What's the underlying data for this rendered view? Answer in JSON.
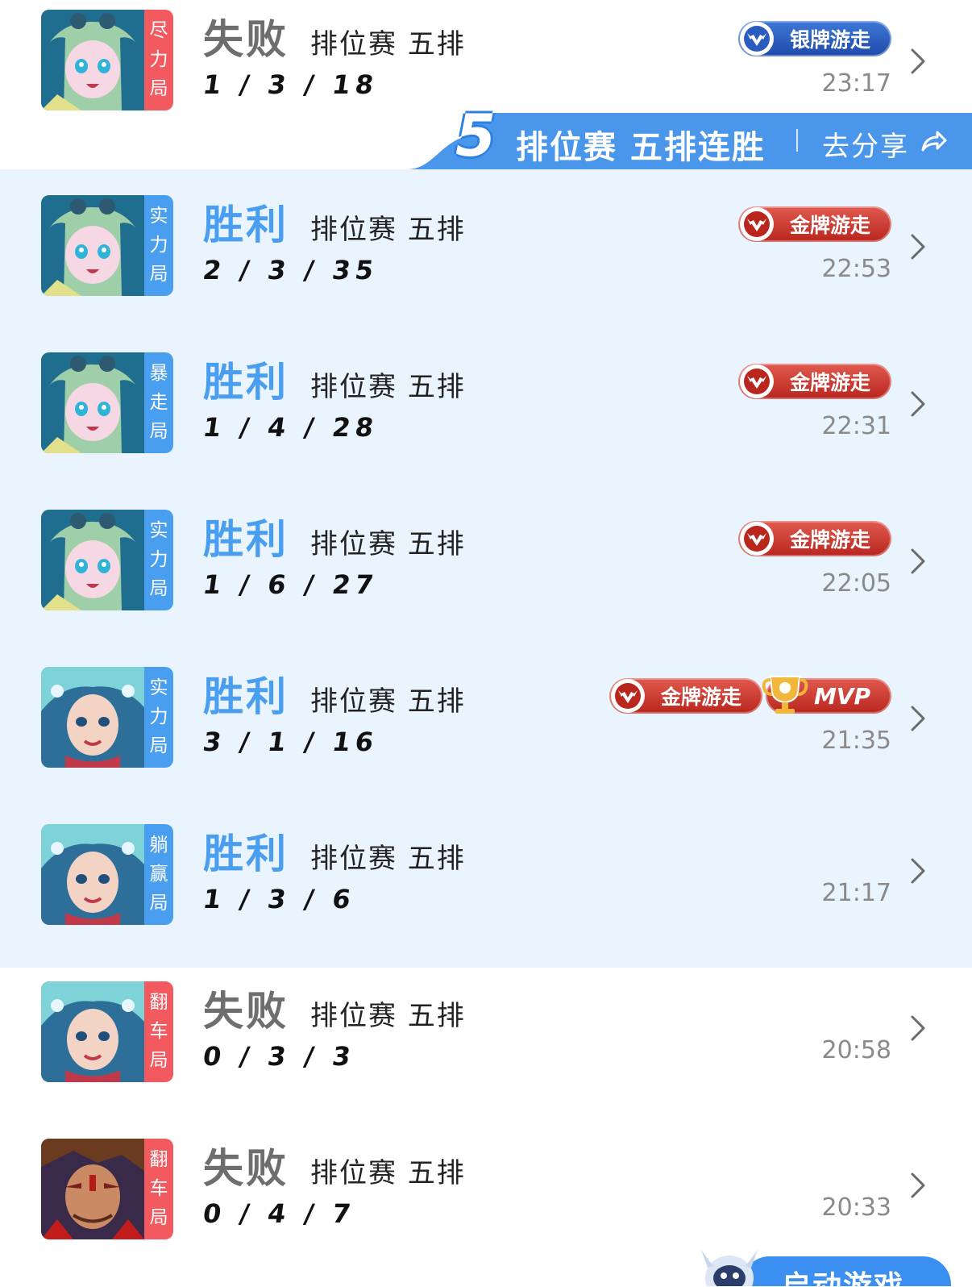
{
  "colors": {
    "win": "#4a9ef0",
    "loss": "#6e6e6e",
    "tag_win": "#4a9ef0",
    "tag_loss": "#f25a5f",
    "highlight_bg": "#e9f4fe",
    "gold_badge": "#c9322a",
    "silver_badge": "#2a5cc0"
  },
  "streak_banner": {
    "count": "5",
    "title": "排位赛 五排连胜",
    "share_label": "去分享",
    "icon": "share-arrow-icon"
  },
  "matches": [
    {
      "hero": "hero-portrait-blue-hair-girl",
      "tag": [
        "尽",
        "力",
        "局"
      ],
      "tag_color": "red",
      "result": "失败",
      "result_type": "loss",
      "mode": "排位赛 五排",
      "kda": "1 / 3 / 18",
      "time": "23:17",
      "badges": [
        {
          "label": "银牌游走",
          "type": "silver"
        }
      ]
    },
    {
      "hero": "hero-portrait-blue-hair-girl",
      "tag": [
        "实",
        "力",
        "局"
      ],
      "tag_color": "blue",
      "result": "胜利",
      "result_type": "win",
      "mode": "排位赛 五排",
      "kda": "2 / 3 / 35",
      "time": "22:53",
      "badges": [
        {
          "label": "金牌游走",
          "type": "gold"
        }
      ]
    },
    {
      "hero": "hero-portrait-blue-hair-girl",
      "tag": [
        "暴",
        "走",
        "局"
      ],
      "tag_color": "blue",
      "result": "胜利",
      "result_type": "win",
      "mode": "排位赛 五排",
      "kda": "1 / 4 / 28",
      "time": "22:31",
      "badges": [
        {
          "label": "金牌游走",
          "type": "gold"
        }
      ]
    },
    {
      "hero": "hero-portrait-blue-hair-girl",
      "tag": [
        "实",
        "力",
        "局"
      ],
      "tag_color": "blue",
      "result": "胜利",
      "result_type": "win",
      "mode": "排位赛 五排",
      "kda": "1 / 6 / 27",
      "time": "22:05",
      "badges": [
        {
          "label": "金牌游走",
          "type": "gold"
        }
      ]
    },
    {
      "hero": "hero-portrait-sea-girl",
      "tag": [
        "实",
        "力",
        "局"
      ],
      "tag_color": "blue",
      "result": "胜利",
      "result_type": "win",
      "mode": "排位赛 五排",
      "kda": "3 / 1 / 16",
      "time": "21:35",
      "badges": [
        {
          "label": "金牌游走",
          "type": "gold"
        },
        {
          "label": "MVP",
          "type": "mvp"
        }
      ]
    },
    {
      "hero": "hero-portrait-sea-girl",
      "tag": [
        "躺",
        "赢",
        "局"
      ],
      "tag_color": "blue",
      "result": "胜利",
      "result_type": "win",
      "mode": "排位赛 五排",
      "kda": "1 / 3 / 6",
      "time": "21:17",
      "badges": []
    },
    {
      "hero": "hero-portrait-sea-girl",
      "tag": [
        "翻",
        "车",
        "局"
      ],
      "tag_color": "red",
      "result": "失败",
      "result_type": "loss",
      "mode": "排位赛 五排",
      "kda": "0 / 3 / 3",
      "time": "20:58",
      "badges": []
    },
    {
      "hero": "hero-portrait-warrior",
      "tag": [
        "翻",
        "车",
        "局"
      ],
      "tag_color": "red",
      "result": "失败",
      "result_type": "loss",
      "mode": "排位赛 五排",
      "kda": "0 / 4 / 7",
      "time": "20:33",
      "badges": []
    }
  ],
  "launch_button": {
    "label": "启动游戏"
  }
}
